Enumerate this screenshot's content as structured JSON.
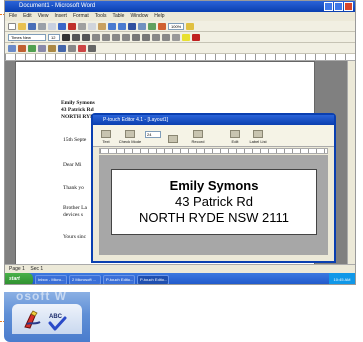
{
  "word_window": {
    "title": "Document1 - Microsoft Word",
    "menu": [
      "File",
      "Edit",
      "View",
      "Insert",
      "Format",
      "Tools",
      "Table",
      "Window",
      "Help"
    ],
    "font_name": "Times New Roman",
    "font_size": "12",
    "zoom_value": "100%",
    "status_left": "Page 1",
    "status_sec": "Sec 1"
  },
  "document": {
    "address_name": "Emily Symons",
    "address_street": "43 Patrick Rd",
    "address_city": "NORTH RYDE NSW 2111",
    "date_line": "15th Septe",
    "salutation": "Dear Mi",
    "body1": "Thank yo",
    "body2": "Brother La",
    "body3": "devices s",
    "body4": "Yours sinc"
  },
  "pinch_editor": {
    "title": "P-touch Editor 4.1 - [Layout1]",
    "tools": [
      {
        "label": "Text"
      },
      {
        "label": "Check Mode"
      },
      {
        "label": "Record"
      },
      {
        "label": "Edit"
      },
      {
        "label": "Label List"
      }
    ],
    "font_size_value": "24",
    "label_line1": "Emily Symons",
    "label_line2": "43 Patrick Rd",
    "label_line3": "NORTH RYDE NSW 2111"
  },
  "taskbar": {
    "start_label": "start",
    "tasks": [
      "Inbox - Micro...",
      "2 Microsoft ...",
      "P-touch Edito...",
      "P-touch Edito..."
    ],
    "clock": "10:45 AM"
  },
  "zoom_tile": {
    "faded_text": "osoft W",
    "icons": [
      "ptouch-icon",
      "spellcheck-icon"
    ]
  },
  "colors": {
    "callout": "#e87a1e",
    "xp_blue": "#0a3fb0",
    "start_green": "#2d8c2d"
  }
}
